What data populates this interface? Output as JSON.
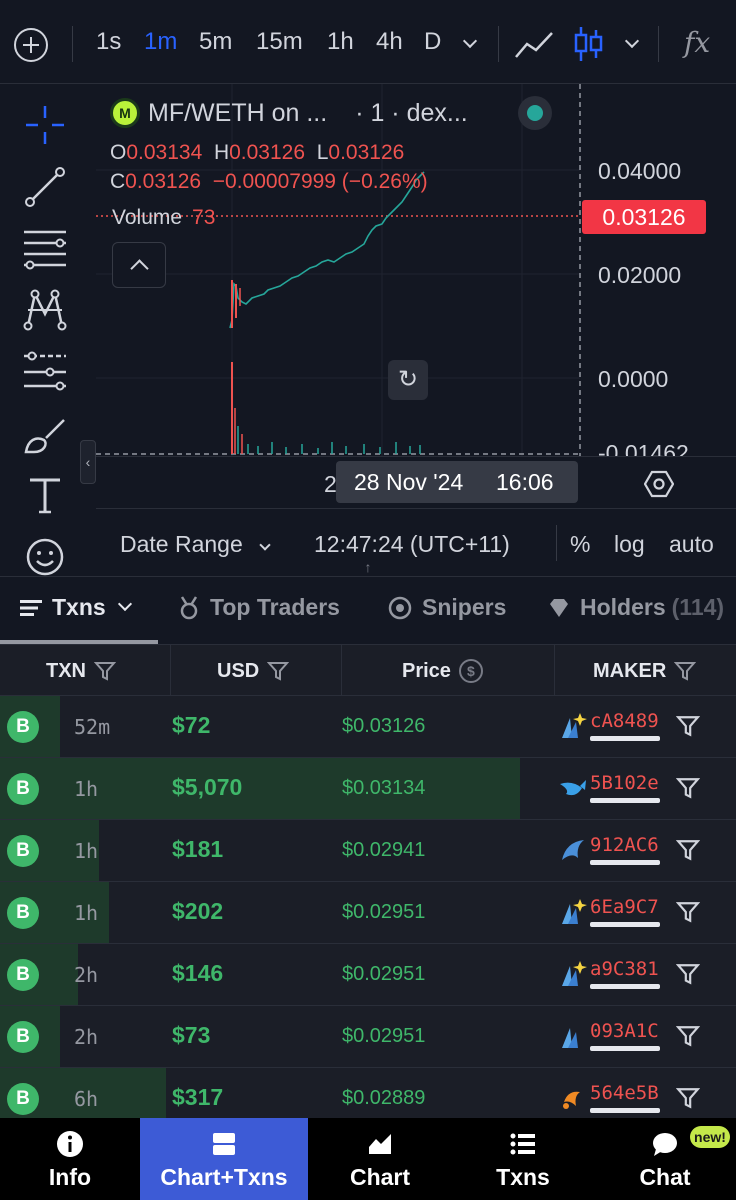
{
  "toolbar": {
    "timeframes": [
      "1s",
      "1m",
      "5m",
      "15m",
      "1h",
      "4h",
      "D"
    ],
    "active_timeframe": "1m",
    "function_symbol": "fx"
  },
  "legend": {
    "symbol": "MF/WETH on ...",
    "interval_source": "· 1 · dex...",
    "logo_letter": "M",
    "o_label": "O",
    "o_value": "0.03134",
    "h_label": "H",
    "h_value": "0.03126",
    "l_label": "L",
    "l_value": "0.03126",
    "c_label": "C",
    "c_value": "0.03126",
    "change": "−0.00007999 (−0.26%)",
    "volume_label": "Volume",
    "volume_value": "73"
  },
  "price_axis": {
    "ticks": [
      "0.04000",
      "0.02000",
      "0.0000",
      "-0.01462"
    ],
    "last_price": "0.03126"
  },
  "time_axis": {
    "prefix": "2",
    "crosshair_date": "28 Nov '24",
    "crosshair_time": "16:06"
  },
  "chart_bottom": {
    "date_range": "Date Range",
    "clock": "12:47:24 (UTC+11)",
    "percent": "%",
    "log": "log",
    "auto": "auto"
  },
  "tabs": {
    "txns": "Txns",
    "top_traders": "Top Traders",
    "snipers": "Snipers",
    "holders": "Holders",
    "holders_count": "(114)"
  },
  "table": {
    "headers": {
      "txn": "TXN",
      "usd": "USD",
      "price": "Price",
      "maker": "MAKER"
    },
    "rows": [
      {
        "type": "B",
        "age": "52m",
        "usd": "$72",
        "price": "$0.03126",
        "maker": "cA8489",
        "icon": "sparkle-fish-icon",
        "size": 0.01
      },
      {
        "type": "B",
        "age": "1h",
        "usd": "$5,070",
        "price": "$0.03134",
        "maker": "5B102e",
        "icon": "whale-icon",
        "size": 1.0
      },
      {
        "type": "B",
        "age": "1h",
        "usd": "$181",
        "price": "$0.02941",
        "maker": "912AC6",
        "icon": "dolphin-icon",
        "size": 0.19
      },
      {
        "type": "B",
        "age": "1h",
        "usd": "$202",
        "price": "$0.02951",
        "maker": "6Ea9C7",
        "icon": "sparkle-fish-icon",
        "size": 0.21
      },
      {
        "type": "B",
        "age": "2h",
        "usd": "$146",
        "price": "$0.02951",
        "maker": "a9C381",
        "icon": "sparkle-fish-icon",
        "size": 0.15
      },
      {
        "type": "B",
        "age": "2h",
        "usd": "$73",
        "price": "$0.02951",
        "maker": "093A1C",
        "icon": "fish-icon",
        "size": 0.08
      },
      {
        "type": "B",
        "age": "6h",
        "usd": "$317",
        "price": "$0.02889",
        "maker": "564e5B",
        "icon": "shrimp-icon",
        "size": 0.32
      }
    ]
  },
  "nav": {
    "info": "Info",
    "chart_txns": "Chart+Txns",
    "chart": "Chart",
    "txns": "Txns",
    "chat": "Chat",
    "new_badge": "new!"
  },
  "colors": {
    "up": "#3fb76a",
    "down": "#ef5350",
    "accent": "#2962ff",
    "nav_active": "#3d5bd6"
  }
}
